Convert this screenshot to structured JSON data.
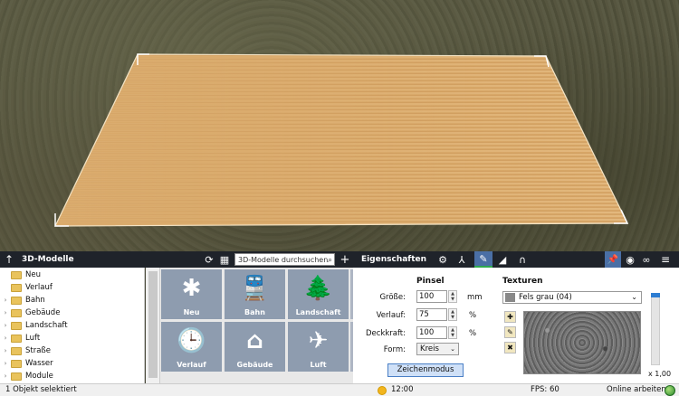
{
  "toolbar": {
    "title_models": "3D-Modelle",
    "search_placeholder": "3D-Modelle durchsuchen",
    "title_properties": "Eigenschaften",
    "up_icon": "arrow-up-icon",
    "refresh_icon": "refresh-icon",
    "grid_icon": "grid-icon",
    "add_icon": "plus-icon",
    "settings_icon": "gear-icon",
    "node_icon": "node-icon",
    "brush_icon": "brush-icon",
    "terrain_icon": "terrain-icon",
    "tunnel_icon": "tunnel-icon",
    "pin_icon": "pin-icon",
    "eye_icon": "eye-icon",
    "link_icon": "link-icon",
    "menu_icon": "menu-icon",
    "active_color": "#4a6fa5",
    "green_color": "#2fa84f"
  },
  "tree": [
    {
      "label": "Neu",
      "expandable": false
    },
    {
      "label": "Verlauf",
      "expandable": false
    },
    {
      "label": "Bahn",
      "expandable": true
    },
    {
      "label": "Gebäude",
      "expandable": true
    },
    {
      "label": "Landschaft",
      "expandable": true
    },
    {
      "label": "Luft",
      "expandable": true
    },
    {
      "label": "Straße",
      "expandable": true
    },
    {
      "label": "Wasser",
      "expandable": true
    },
    {
      "label": "Module",
      "expandable": true
    }
  ],
  "tiles": [
    {
      "label": "Neu",
      "icon": "snowflake-icon",
      "glyph": "✱"
    },
    {
      "label": "Bahn",
      "icon": "train-icon",
      "glyph": "🚆"
    },
    {
      "label": "Landschaft",
      "icon": "tree-icon",
      "glyph": "🌲"
    },
    {
      "label": "Verlauf",
      "icon": "clock-icon",
      "glyph": "🕒"
    },
    {
      "label": "Gebäude",
      "icon": "house-icon",
      "glyph": "⌂"
    },
    {
      "label": "Luft",
      "icon": "airplane-icon",
      "glyph": "✈"
    }
  ],
  "brush": {
    "heading": "Pinsel",
    "size_label": "Größe:",
    "size_value": "100",
    "size_unit": "mm",
    "gradient_label": "Verlauf:",
    "gradient_value": "75",
    "gradient_unit": "%",
    "opacity_label": "Deckkraft:",
    "opacity_value": "100",
    "opacity_unit": "%",
    "form_label": "Form:",
    "form_value": "Kreis",
    "draw_mode_label": "Zeichenmodus"
  },
  "textures": {
    "heading": "Texturen",
    "selected": "Fels grau (04)",
    "scale_label": "x 1,00",
    "slider_level": 1.0
  },
  "status": {
    "selection": "1 Objekt selektiert",
    "time": "12:00",
    "fps": "FPS: 60",
    "online": "Online arbeiten"
  }
}
